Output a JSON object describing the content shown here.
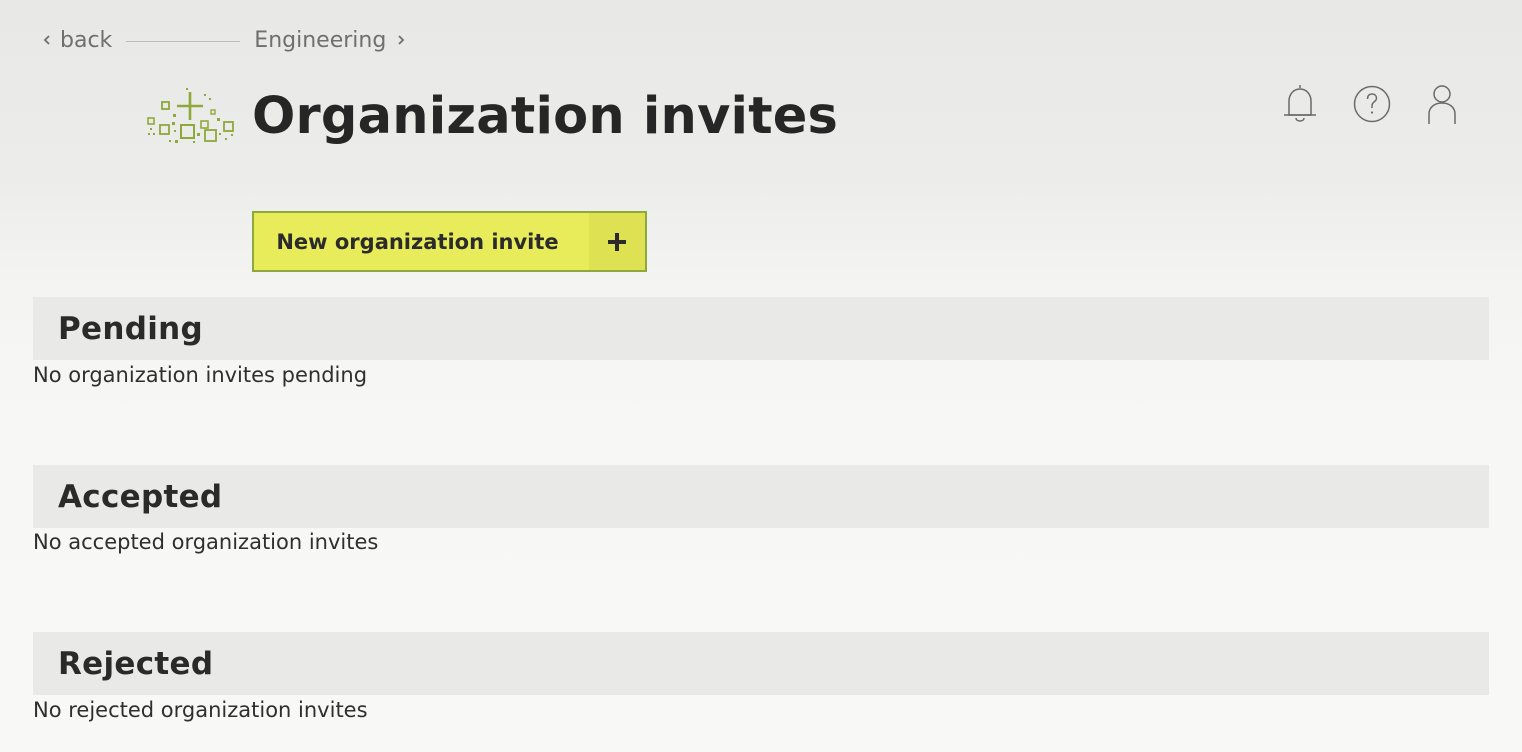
{
  "nav": {
    "back_label": "back",
    "breadcrumb": "Engineering"
  },
  "header": {
    "title": "Organization invites",
    "icons": [
      "bell-icon",
      "help-icon",
      "user-icon"
    ]
  },
  "actions": {
    "new_invite_label": "New organization invite",
    "new_invite_icon": "plus-icon"
  },
  "sections": [
    {
      "title": "Pending",
      "empty_text": "No organization invites pending"
    },
    {
      "title": "Accepted",
      "empty_text": "No accepted organization invites"
    },
    {
      "title": "Rejected",
      "empty_text": "No rejected organization invites"
    }
  ],
  "colors": {
    "accent": "#e8ec5a",
    "accent_border": "#8da83b",
    "logo_green": "#8fa83a",
    "section_bg": "#e9e9e7"
  }
}
